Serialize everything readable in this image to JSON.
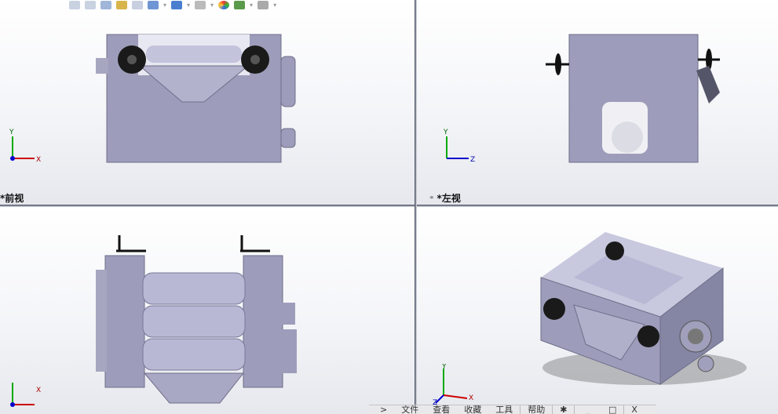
{
  "toolbar": {
    "icons": [
      "zoom-to-fit-icon",
      "zoom-area-icon",
      "previous-view-icon",
      "section-view-icon",
      "dynamic-annotation-icon",
      "view-orientation-icon",
      "display-style-icon",
      "hide-show-items-icon",
      "edit-appearance-icon",
      "apply-scene-icon",
      "view-settings-icon"
    ]
  },
  "viewports": [
    {
      "label": "*前视"
    },
    {
      "label": "*左视"
    },
    {
      "label": ""
    },
    {
      "label": ""
    }
  ],
  "triad": {
    "x": "X",
    "y": "Y",
    "z": "Z"
  },
  "menubar": {
    "arrow": ">",
    "items": [
      "文件",
      "查看",
      "收藏",
      "工具",
      "帮助"
    ],
    "minimize": "_",
    "maximize": "□",
    "close": "X"
  },
  "colors": {
    "body": "#9d9dbb",
    "roller": "#b8b8d4",
    "knob": "#1a1a1a",
    "splitter": "#8a8f9c"
  }
}
